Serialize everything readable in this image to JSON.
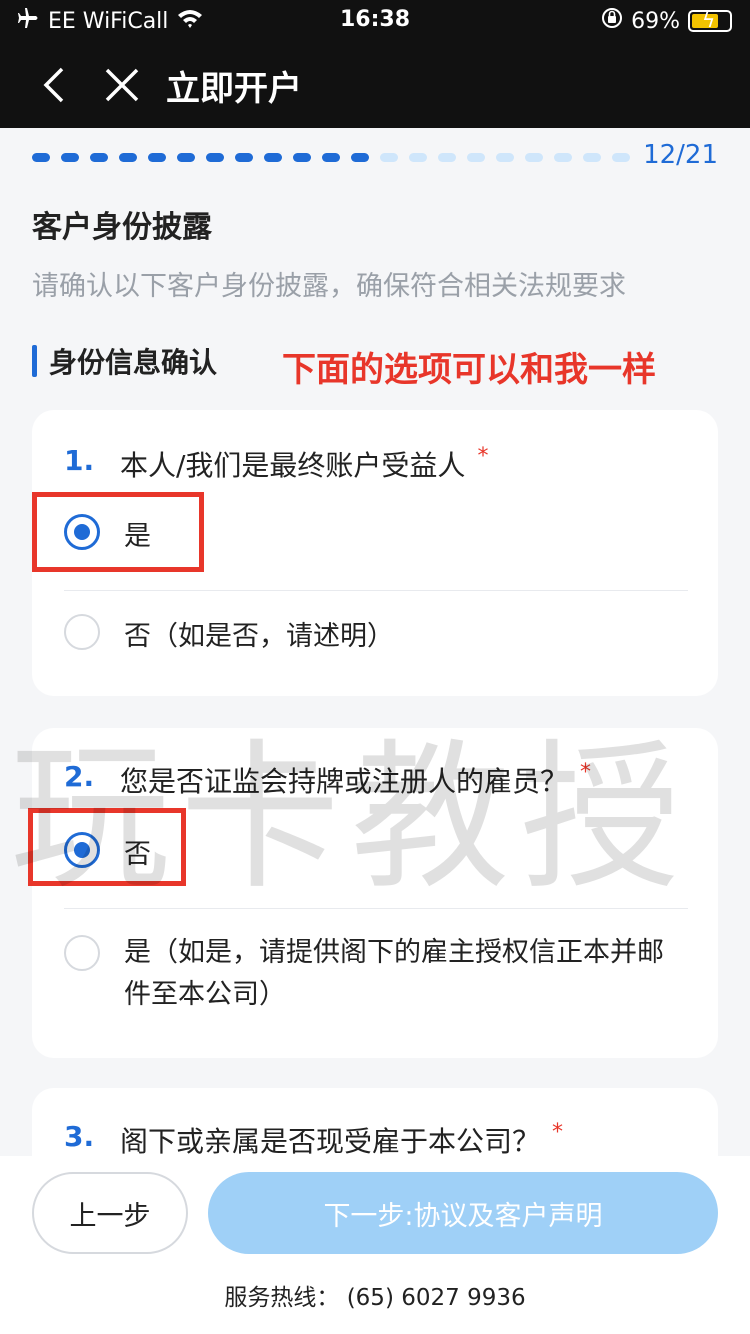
{
  "status_bar": {
    "carrier": "EE WiFiCall",
    "time": "16:38",
    "battery": "69%"
  },
  "nav": {
    "title": "立即开户"
  },
  "progress": {
    "current": 12,
    "total": 21,
    "label": "12/21"
  },
  "section": {
    "title": "客户身份披露",
    "subtitle": "请确认以下客户身份披露，确保符合相关法规要求"
  },
  "group": {
    "title": "身份信息确认"
  },
  "annotation": "下面的选项可以和我一样",
  "watermark": "玩卡教授",
  "questions": [
    {
      "num": "1.",
      "text": "本人/我们是最终账户受益人",
      "required": "*",
      "options": [
        {
          "label": "是",
          "selected": true
        },
        {
          "label": "否（如是否，请述明）",
          "selected": false
        }
      ]
    },
    {
      "num": "2.",
      "text": "您是否证监会持牌或注册人的雇员？",
      "required": "*",
      "options": [
        {
          "label": "否",
          "selected": true
        },
        {
          "label": "是（如是，请提供阁下的雇主授权信正本并邮件至本公司）",
          "selected": false
        }
      ]
    },
    {
      "num": "3.",
      "text": "阁下或亲属是否现受雇于本公司？",
      "required": "*"
    }
  ],
  "footer": {
    "prev_label": "上一步",
    "next_label": "下一步:协议及客户声明",
    "hotline": "服务热线： (65) 6027 9936"
  },
  "colors": {
    "accent": "#1f6bd6",
    "required": "#e8362a",
    "next_disabled": "#9fd0f7"
  }
}
